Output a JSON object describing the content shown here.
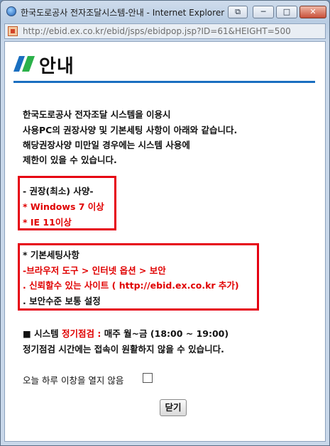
{
  "window": {
    "title": "한국도로공사 전자조달시스템-안내 - Internet Explorer",
    "controls": {
      "restore": "⧉",
      "minimize": "─",
      "maximize": "□",
      "close": "✕"
    }
  },
  "address": {
    "url": "http://ebid.ex.co.kr/ebid/jsps/ebidpop.jsp?ID=61&HEIGHT=500"
  },
  "page": {
    "heading": "안내",
    "intro": [
      "한국도로공사 전자조달 시스템을 이용시",
      "사용PC의 권장사양 및 기본세팅 사항이 아래와 같습니다.",
      "해당권장사양 미만일 경우에는 시스템 사용에",
      "제한이 있을 수 있습니다."
    ],
    "spec": {
      "title": "- 권장(최소) 사양-",
      "items": [
        "* Windows 7 이상",
        "* IE 11이상"
      ]
    },
    "settings": {
      "title": "* 기본세팅사항",
      "line1": "-브라우저 도구 > 인터넷 옵션 > 보안",
      "line2": ". 신뢰할수 있는 사이트 ( http://ebid.ex.co.kr 추가)",
      "line3": ". 보안수준 보통 설정"
    },
    "maintenance": {
      "prefix": "■ 시스템 ",
      "highlight": "정기점검 :",
      "schedule": " 매주 월~금 (18:00 ~ 19:00)",
      "note": "정기점검 시간에는 접속이 원활하지 않을 수 있습니다."
    },
    "dont_show_label": "오늘 하루 이창을 열지 않음",
    "close_button": "닫기"
  },
  "colors": {
    "accent_blue": "#1a6fc0",
    "logo_green": "#2bb14a",
    "highlight_red": "#e00000",
    "box_red": "#e60012"
  }
}
